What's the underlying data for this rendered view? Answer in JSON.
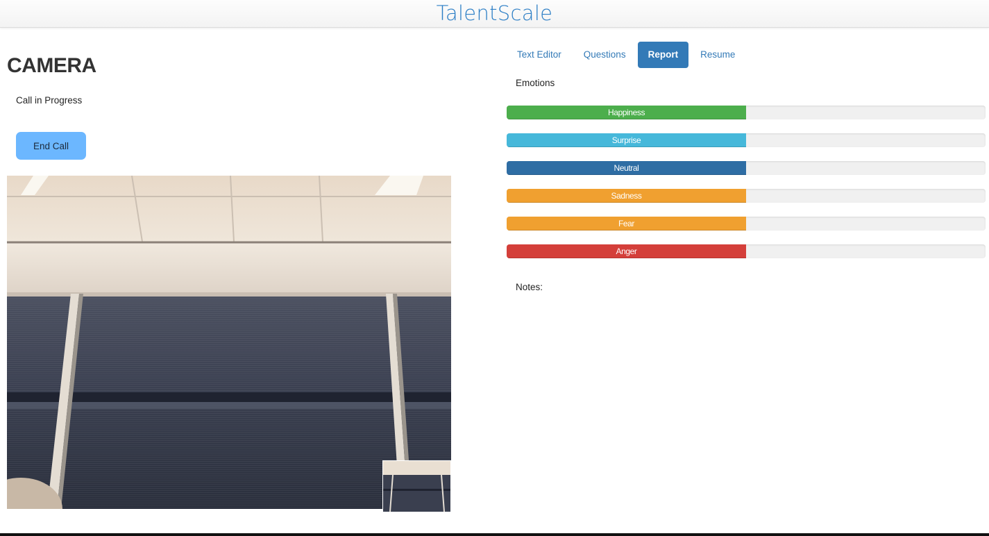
{
  "header": {
    "brand": "TalentScale",
    "brand_color": "#2d7fc6"
  },
  "camera": {
    "title": "CAMERA",
    "status": "Call in Progress",
    "end_call_label": "End Call",
    "end_call_color": "#6cb7ff"
  },
  "tabs": [
    {
      "label": "Text Editor",
      "active": false
    },
    {
      "label": "Questions",
      "active": false
    },
    {
      "label": "Report",
      "active": true
    },
    {
      "label": "Resume",
      "active": false
    }
  ],
  "report": {
    "emotions_label": "Emotions",
    "notes_label": "Notes:",
    "emotions": [
      {
        "name": "Happiness",
        "percent": 50,
        "color": "#4cae4c"
      },
      {
        "name": "Surprise",
        "percent": 50,
        "color": "#46b8da"
      },
      {
        "name": "Neutral",
        "percent": 50,
        "color": "#2e6da4"
      },
      {
        "name": "Sadness",
        "percent": 50,
        "color": "#f0a030"
      },
      {
        "name": "Fear",
        "percent": 50,
        "color": "#f0a030"
      },
      {
        "name": "Anger",
        "percent": 50,
        "color": "#d43f3a"
      }
    ]
  }
}
